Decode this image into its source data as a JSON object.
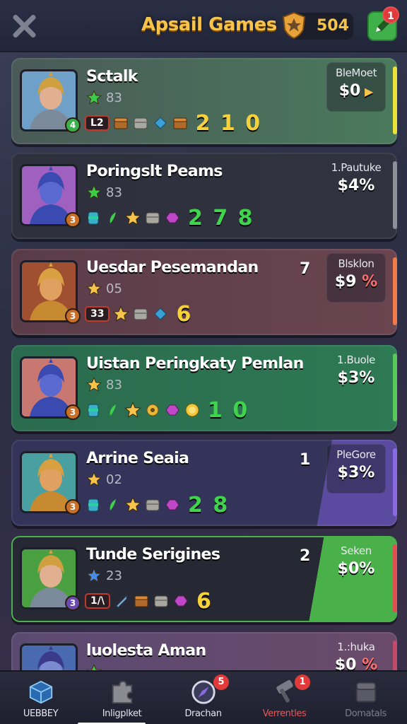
{
  "header": {
    "title": "Apsail Games",
    "coins": "504",
    "edit_badge": "1"
  },
  "cards": [
    {
      "name": "Sctalk",
      "stat": "83",
      "star_color": "#3ecb4a",
      "rank_tag": "L2",
      "score": "2 1 0",
      "score_color": "#f6d23a",
      "level": "4",
      "corner": "",
      "price_label": "BleMoet",
      "price_value": "$0",
      "price_suffix": "▶",
      "bg": "#4c6a5a",
      "accent": "#e8e23a"
    },
    {
      "name": "Poringslt Peams",
      "stat": "83",
      "star_color": "#3ecb4a",
      "rank_tag": "",
      "score": "2 7 8",
      "score_color": "#3fd44c",
      "level": "3",
      "corner": "",
      "price_label": "1.Pautuke",
      "price_value": "$4%",
      "price_suffix": "",
      "bg": "#2f3140",
      "accent": "#8d8f99"
    },
    {
      "name": "Uesdar Pesemandan",
      "stat": "05",
      "star_color": "#f6c44a",
      "rank_tag": "33",
      "score": "6",
      "score_color": "#f6d23a",
      "level": "3",
      "corner": "7",
      "price_label": "Blsklon",
      "price_value": "$9",
      "price_suffix": "%",
      "bg": "#6a4550",
      "accent": "#f07a4a"
    },
    {
      "name": "Uistan Peringkaty Pemlan",
      "stat": "83",
      "star_color": "#f6c44a",
      "rank_tag": "",
      "score": "1 0",
      "score_color": "#3fd44c",
      "level": "3",
      "corner": "",
      "price_label": "1.Buole",
      "price_value": "$3%",
      "price_suffix": "",
      "bg": "#2e7a54",
      "accent": "#5ac85a"
    },
    {
      "name": "Arrine Seaia",
      "stat": "02",
      "star_color": "#f6c44a",
      "rank_tag": "",
      "score": "2 8",
      "score_color": "#3fd44c",
      "level": "3",
      "corner": "1",
      "price_label": "PleGore",
      "price_value": "$3%",
      "price_suffix": "",
      "bg": "#3e3a6a",
      "accent": "#8a6ae0"
    },
    {
      "name": "Tunde Serigines",
      "stat": "23",
      "star_color": "#4a8ae0",
      "rank_tag": "1/\\",
      "score": "6",
      "score_color": "#f6d23a",
      "level": "3",
      "corner": "2",
      "price_label": "Seken",
      "price_value": "$0%",
      "price_suffix": "",
      "bg": "#262834",
      "accent": "#e05050"
    },
    {
      "name": "luolesta Aman",
      "stat": "",
      "star_color": "#3ecb4a",
      "rank_tag": "",
      "score": "",
      "score_color": "#3fd44c",
      "level": "",
      "corner": "",
      "price_label": "1.:huka",
      "price_value": "$0",
      "price_suffix": "%",
      "bg": "#5a4a6a",
      "accent": "#c04a6a"
    }
  ],
  "nav": [
    {
      "label": "UEBBEY",
      "badge": "",
      "style": "normal",
      "icon": "cube-icon"
    },
    {
      "label": "Inligplket",
      "badge": "",
      "style": "normal",
      "icon": "puzzle-icon"
    },
    {
      "label": "Drachan",
      "badge": "5",
      "style": "normal",
      "icon": "compass-icon"
    },
    {
      "label": "Verrentles",
      "badge": "1",
      "style": "red",
      "icon": "hammer-icon"
    },
    {
      "label": "Domatals",
      "badge": "",
      "style": "dim",
      "icon": "chest-icon"
    }
  ]
}
